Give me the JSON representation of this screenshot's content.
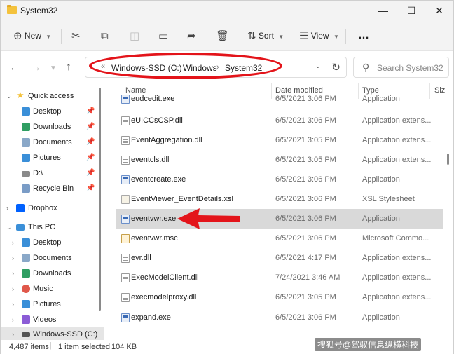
{
  "window": {
    "title": "System32",
    "controls": [
      "minimize-icon",
      "maximize-icon",
      "close-icon"
    ]
  },
  "toolbar": {
    "new_label": "New",
    "sort_label": "Sort",
    "view_label": "View",
    "more_label": "…"
  },
  "address": {
    "crumbs": [
      "Windows-SSD (C:)",
      "Windows",
      "System32"
    ],
    "overflow": "«"
  },
  "search": {
    "placeholder": "Search System32"
  },
  "sidebar": {
    "items": [
      {
        "label": "Quick access",
        "icon": "star-icon",
        "color": "#f4c23c"
      },
      {
        "label": "Desktop",
        "icon": "desktop-folder-icon",
        "color": "#3a8fd8",
        "pinned": true
      },
      {
        "label": "Downloads",
        "icon": "downloads-folder-icon",
        "color": "#2f9e62",
        "pinned": true
      },
      {
        "label": "Documents",
        "icon": "documents-folder-icon",
        "color": "#8aa8c8",
        "pinned": true
      },
      {
        "label": "Pictures",
        "icon": "pictures-folder-icon",
        "color": "#3a8fd8",
        "pinned": true
      },
      {
        "label": "D:\\",
        "icon": "drive-icon",
        "color": "#8a8a8a",
        "pinned": true
      },
      {
        "label": "Recycle Bin",
        "icon": "recycle-bin-icon",
        "color": "#7a9cc6",
        "pinned": true
      },
      {
        "label": "Dropbox",
        "icon": "dropbox-icon",
        "color": "#0061fe"
      },
      {
        "label": "This PC",
        "icon": "pc-icon",
        "color": "#3a8fd8"
      },
      {
        "label": "Desktop",
        "icon": "desktop-folder-icon",
        "color": "#3a8fd8"
      },
      {
        "label": "Documents",
        "icon": "documents-folder-icon",
        "color": "#8aa8c8"
      },
      {
        "label": "Downloads",
        "icon": "downloads-folder-icon",
        "color": "#2f9e62"
      },
      {
        "label": "Music",
        "icon": "music-folder-icon",
        "color": "#e0584a"
      },
      {
        "label": "Pictures",
        "icon": "pictures-folder-icon",
        "color": "#3a8fd8"
      },
      {
        "label": "Videos",
        "icon": "videos-folder-icon",
        "color": "#8b5cd6"
      },
      {
        "label": "Windows-SSD (C:)",
        "icon": "drive-c-icon",
        "color": "#555555"
      }
    ]
  },
  "list": {
    "columns": {
      "name": "Name",
      "date": "Date modified",
      "type": "Type",
      "size": "Siz"
    },
    "rows": [
      {
        "name": "eudcedit.exe",
        "date": "6/5/2021 3:06 PM",
        "type": "Application",
        "kind": "exe"
      },
      {
        "name": "eUICCsCSP.dll",
        "date": "6/5/2021 3:06 PM",
        "type": "Application extens...",
        "kind": "dll"
      },
      {
        "name": "EventAggregation.dll",
        "date": "6/5/2021 3:05 PM",
        "type": "Application extens...",
        "kind": "dll"
      },
      {
        "name": "eventcls.dll",
        "date": "6/5/2021 3:05 PM",
        "type": "Application extens...",
        "kind": "dll"
      },
      {
        "name": "eventcreate.exe",
        "date": "6/5/2021 3:06 PM",
        "type": "Application",
        "kind": "exe"
      },
      {
        "name": "EventViewer_EventDetails.xsl",
        "date": "6/5/2021 3:06 PM",
        "type": "XSL Stylesheet",
        "kind": "xsl"
      },
      {
        "name": "eventvwr.exe",
        "date": "6/5/2021 3:06 PM",
        "type": "Application",
        "kind": "exe",
        "selected": true
      },
      {
        "name": "eventvwr.msc",
        "date": "6/5/2021 3:06 PM",
        "type": "Microsoft Commo...",
        "kind": "msc"
      },
      {
        "name": "evr.dll",
        "date": "6/5/2021 4:17 PM",
        "type": "Application extens...",
        "kind": "dll"
      },
      {
        "name": "ExecModelClient.dll",
        "date": "7/24/2021 3:46 AM",
        "type": "Application extens...",
        "kind": "dll"
      },
      {
        "name": "execmodelproxy.dll",
        "date": "6/5/2021 3:05 PM",
        "type": "Application extens...",
        "kind": "dll"
      },
      {
        "name": "expand.exe",
        "date": "6/5/2021 3:06 PM",
        "type": "Application",
        "kind": "exe"
      }
    ]
  },
  "status": {
    "item_count": "4,487 items",
    "selection": "1 item selected",
    "size": "104 KB"
  },
  "annotations": {
    "color": "#e3141a"
  },
  "watermark": "搜狐号@驾驭信息纵横科技"
}
